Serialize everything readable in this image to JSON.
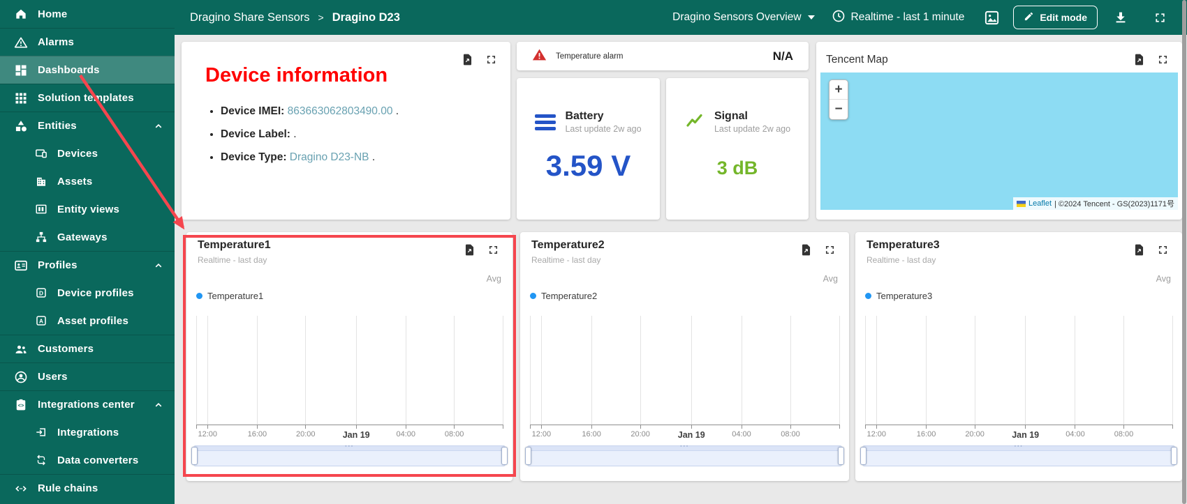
{
  "colors": {
    "primary_teal": "#0a685c",
    "selected_item": "rgba(255,255,255,0.22)",
    "content_bg": "#e9e9e9",
    "battery_blue": "#2454c7",
    "signal_green": "#74b62a",
    "legend_dot_blue": "#2196f3",
    "alarm_red": "#d3302f",
    "info_title_red": "#ff0000",
    "annotation_red": "#f5464e",
    "link_teal": "#68a1b1",
    "map_water": "#8ddcf3",
    "leaflet_link": "#0078a8"
  },
  "sidebar": {
    "items": [
      {
        "label": "Home",
        "icon": "home-icon",
        "level": 0,
        "selected": false,
        "divided": false,
        "expandable": false
      },
      {
        "label": "Alarms",
        "icon": "alarms-icon",
        "level": 0,
        "selected": false,
        "divided": true,
        "expandable": false
      },
      {
        "label": "Dashboards",
        "icon": "dashboards-icon",
        "level": 0,
        "selected": true,
        "divided": true,
        "expandable": false
      },
      {
        "label": "Solution templates",
        "icon": "solution-templates-icon",
        "level": 0,
        "selected": false,
        "divided": true,
        "expandable": false
      },
      {
        "label": "Entities",
        "icon": "entities-icon",
        "level": 0,
        "selected": false,
        "divided": true,
        "expandable": true
      },
      {
        "label": "Devices",
        "icon": "devices-icon",
        "level": 1,
        "selected": false,
        "divided": false,
        "expandable": false
      },
      {
        "label": "Assets",
        "icon": "assets-icon",
        "level": 1,
        "selected": false,
        "divided": false,
        "expandable": false
      },
      {
        "label": "Entity views",
        "icon": "entity-views-icon",
        "level": 1,
        "selected": false,
        "divided": false,
        "expandable": false
      },
      {
        "label": "Gateways",
        "icon": "gateways-icon",
        "level": 1,
        "selected": false,
        "divided": false,
        "expandable": false
      },
      {
        "label": "Profiles",
        "icon": "profiles-icon",
        "level": 0,
        "selected": false,
        "divided": true,
        "expandable": true
      },
      {
        "label": "Device profiles",
        "icon": "device-profiles-icon",
        "level": 1,
        "selected": false,
        "divided": false,
        "expandable": false
      },
      {
        "label": "Asset profiles",
        "icon": "asset-profiles-icon",
        "level": 1,
        "selected": false,
        "divided": false,
        "expandable": false
      },
      {
        "label": "Customers",
        "icon": "customers-icon",
        "level": 0,
        "selected": false,
        "divided": true,
        "expandable": false
      },
      {
        "label": "Users",
        "icon": "users-icon",
        "level": 0,
        "selected": false,
        "divided": true,
        "expandable": false
      },
      {
        "label": "Integrations center",
        "icon": "integrations-center-icon",
        "level": 0,
        "selected": false,
        "divided": true,
        "expandable": true
      },
      {
        "label": "Integrations",
        "icon": "integrations-icon",
        "level": 1,
        "selected": false,
        "divided": false,
        "expandable": false
      },
      {
        "label": "Data converters",
        "icon": "data-converters-icon",
        "level": 1,
        "selected": false,
        "divided": false,
        "expandable": false
      },
      {
        "label": "Rule chains",
        "icon": "rule-chains-icon",
        "level": 0,
        "selected": false,
        "divided": true,
        "expandable": false
      }
    ]
  },
  "header": {
    "breadcrumb_parent": "Dragino Share Sensors",
    "breadcrumb_sep": ">",
    "breadcrumb_current": "Dragino D23",
    "dashboard_select": "Dragino Sensors Overview",
    "timewindow": "Realtime - last 1 minute",
    "edit_mode_label": "Edit mode"
  },
  "cards": {
    "device_info": {
      "title": "Device information",
      "items": [
        {
          "label": "Device IMEI:",
          "value": "863663062803490.00",
          "suffix": " ."
        },
        {
          "label": "Device Label:",
          "value": "",
          "suffix": " ."
        },
        {
          "label": "Device Type:",
          "value": "Dragino D23-NB",
          "suffix": " ."
        }
      ]
    },
    "alarm": {
      "title": "Temperature alarm",
      "value": "N/A"
    },
    "battery": {
      "title": "Battery",
      "subtitle": "Last update 2w ago",
      "value": "3.59 V"
    },
    "signal": {
      "title": "Signal",
      "subtitle": "Last update 2w ago",
      "value": "3 dB"
    },
    "map": {
      "title": "Tencent Map",
      "zoom_in": "+",
      "zoom_out": "−",
      "attribution_link": "Leaflet",
      "attribution_text": "| ©2024 Tencent - GS(2023)1171号"
    }
  },
  "chart_axis": {
    "ticks": [
      "12:00",
      "16:00",
      "20:00",
      "Jan 19",
      "04:00",
      "08:00"
    ],
    "tick_positions_pct": [
      3.7,
      19.9,
      35.7,
      52.2,
      68.4,
      84.2
    ],
    "major_tick_index": 3
  },
  "chart_data": [
    {
      "type": "line",
      "title": "Temperature1",
      "subtitle": "Realtime - last day",
      "aggregation": "Avg",
      "legend": [
        "Temperature1"
      ],
      "x_ticks": [
        "12:00",
        "16:00",
        "20:00",
        "Jan 19",
        "04:00",
        "08:00"
      ],
      "series": [
        {
          "name": "Temperature1",
          "values": []
        }
      ],
      "grid": "vertical-gridlines",
      "legend_position": "top-left",
      "note": "no data points rendered in visible window",
      "annotated": true
    },
    {
      "type": "line",
      "title": "Temperature2",
      "subtitle": "Realtime - last day",
      "aggregation": "Avg",
      "legend": [
        "Temperature2"
      ],
      "x_ticks": [
        "12:00",
        "16:00",
        "20:00",
        "Jan 19",
        "04:00",
        "08:00"
      ],
      "series": [
        {
          "name": "Temperature2",
          "values": []
        }
      ],
      "grid": "vertical-gridlines",
      "legend_position": "top-left",
      "note": "no data points rendered in visible window",
      "annotated": false
    },
    {
      "type": "line",
      "title": "Temperature3",
      "subtitle": "Realtime - last day",
      "aggregation": "Avg",
      "legend": [
        "Temperature3"
      ],
      "x_ticks": [
        "12:00",
        "16:00",
        "20:00",
        "Jan 19",
        "04:00",
        "08:00"
      ],
      "series": [
        {
          "name": "Temperature3",
          "values": []
        }
      ],
      "grid": "vertical-gridlines",
      "legend_position": "top-left",
      "note": "no data points rendered in visible window",
      "annotated": false
    }
  ]
}
